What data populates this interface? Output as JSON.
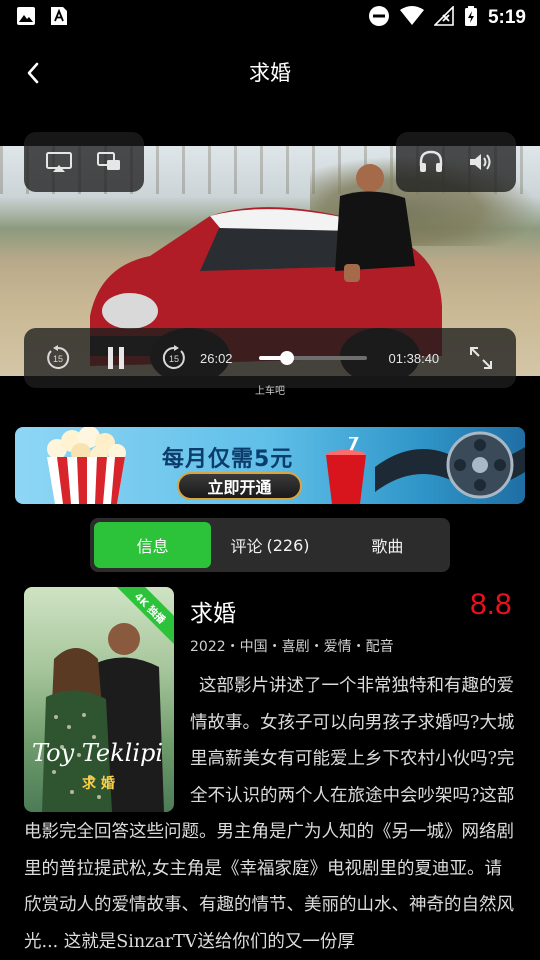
{
  "status": {
    "time": "5:19"
  },
  "header": {
    "title": "求婚"
  },
  "player": {
    "current_time": "26:02",
    "total_time": "01:38:40",
    "progress": 0.26,
    "subtitle": "上车吧"
  },
  "banner": {
    "title": "每月仅需5元",
    "cta": "立即开通"
  },
  "tabs": [
    {
      "label": "信息",
      "count": ""
    },
    {
      "label": "评论",
      "count": "(226)"
    },
    {
      "label": "歌曲",
      "count": ""
    }
  ],
  "movie": {
    "title": "求婚",
    "rating": "8.8",
    "meta": "2022・中国・喜剧・爱情・配音",
    "poster_title": "Toy Teklipi",
    "poster_subtitle": "求 婚",
    "badge": "4K 独播",
    "description": "这部影片讲述了一个非常独特和有趣的爱情故事。女孩子可以向男孩子求婚吗?大城里高薪美女有可能爱上乡下农村小伙吗?完全不认识的两个人在旅途中会吵架吗?这部电影完全回答这些问题。男主角是广为人知的《另一城》网络剧里的普拉提武松,女主角是《幸福家庭》电视剧里的夏迪亚。请欣赏动人的爱情故事、有趣的情节、美丽的山水、神奇的自然风光... 这就是SinzarTV送给你们的又一份厚"
  },
  "colors": {
    "accent": "#2cc23a",
    "rating": "#e8111d",
    "background": "#000000"
  }
}
